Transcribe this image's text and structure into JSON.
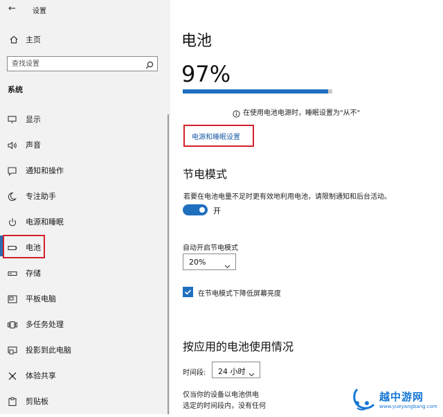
{
  "window": {
    "back_glyph": "←",
    "title": "设置"
  },
  "sidebar": {
    "home_label": "主页",
    "search_placeholder": "查找设置",
    "section_title": "系统",
    "items": [
      {
        "label": "显示",
        "icon": "display-icon"
      },
      {
        "label": "声音",
        "icon": "sound-icon"
      },
      {
        "label": "通知和操作",
        "icon": "notification-icon"
      },
      {
        "label": "专注助手",
        "icon": "moon-icon"
      },
      {
        "label": "电源和睡眠",
        "icon": "power-icon"
      },
      {
        "label": "电池",
        "icon": "battery-icon",
        "active": true
      },
      {
        "label": "存储",
        "icon": "storage-icon"
      },
      {
        "label": "平板电脑",
        "icon": "tablet-icon"
      },
      {
        "label": "多任务处理",
        "icon": "multitask-icon"
      },
      {
        "label": "投影到此电脑",
        "icon": "project-icon"
      },
      {
        "label": "体验共享",
        "icon": "share-icon"
      },
      {
        "label": "剪贴板",
        "icon": "clipboard-icon"
      }
    ]
  },
  "main": {
    "title": "电池",
    "battery_percent_text": "97%",
    "battery_level": 0.97,
    "info_text": "在使用电池电源时，睡眠设置为\"从不\"",
    "link_label": "电源和睡眠设置",
    "saver": {
      "heading": "节电模式",
      "description": "若要在电池电量不足时更有效地利用电池，请限制通知和后台活动。",
      "toggle_label": "开",
      "toggle_on": true,
      "auto_label": "自动开启节电模式",
      "threshold_value": "20%",
      "checkbox_label": "在节电模式下降低屏幕亮度",
      "checkbox_checked": true
    },
    "usage": {
      "heading": "按应用的电池使用情况",
      "period_label": "时间段:",
      "period_value": "24 小时",
      "footer_line1": "仅当你的设备以电池供电",
      "footer_line2": "选定的时间段内，没有任何"
    }
  },
  "watermark": {
    "text": "越中游网",
    "url": "www.yueyangbang.com"
  },
  "colors": {
    "accent": "#1f6fbf",
    "highlight": "#d21f2a",
    "sidebar_bg": "#f2f2f2"
  }
}
